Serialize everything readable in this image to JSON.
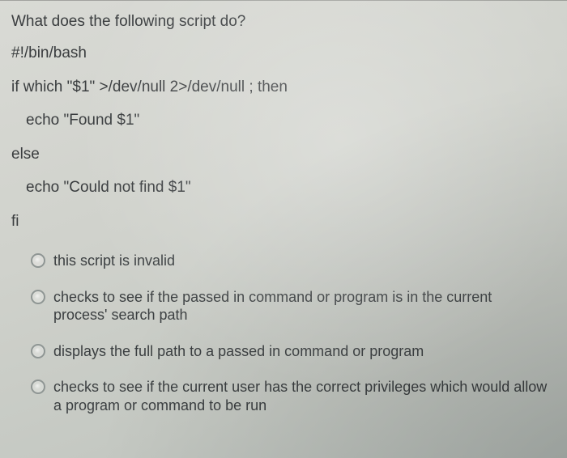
{
  "question": "What does the following script do?",
  "code_lines": [
    {
      "text": "#!/bin/bash",
      "indent": 0
    },
    {
      "text": "if which \"$1\" >/dev/null 2>/dev/null ; then",
      "indent": 0
    },
    {
      "text": "echo \"Found $1\"",
      "indent": 1
    },
    {
      "text": "else",
      "indent": 0
    },
    {
      "text": "echo \"Could not find $1\"",
      "indent": 1
    },
    {
      "text": "fi",
      "indent": 0
    }
  ],
  "answers": [
    {
      "text": "this script is invalid"
    },
    {
      "text": "checks to see if the passed in command or program is in the current process' search path"
    },
    {
      "text": "displays the full path to a passed in command or program"
    },
    {
      "text": "checks to see if the current user has the correct privileges which would allow a program or command to be run"
    }
  ]
}
